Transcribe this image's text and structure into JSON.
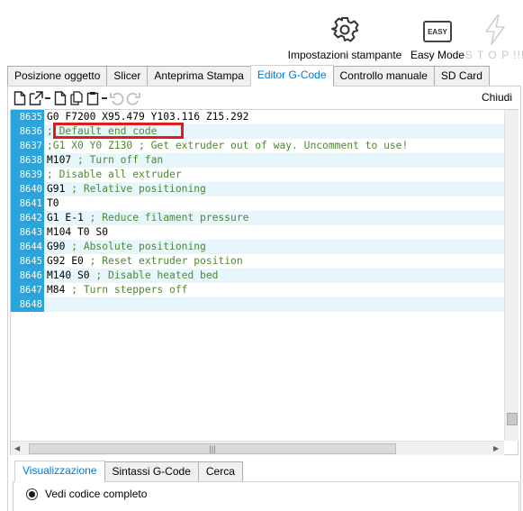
{
  "toolbar": {
    "settings_label": "Impostazioni stampante",
    "settings_icon": "gear-icon",
    "easy_label": "Easy Mode",
    "easy_badge": "EASY",
    "stop_label": "S T O P !!!",
    "stop_icon": "lightning-icon"
  },
  "main_tabs": [
    {
      "label": "Posizione oggetto"
    },
    {
      "label": "Slicer"
    },
    {
      "label": "Anteprima Stampa"
    },
    {
      "label": "Editor G-Code",
      "active": true
    },
    {
      "label": "Controllo manuale"
    },
    {
      "label": "SD Card"
    }
  ],
  "editor_toolbar": {
    "icons": [
      "new-file-icon",
      "export-icon",
      "separator",
      "file-icon",
      "copy-icon",
      "paste-icon",
      "separator",
      "undo-icon",
      "redo-icon"
    ],
    "close_label": "Chiudi"
  },
  "code_lines": [
    {
      "num": "8635",
      "cmd": "G0 F7200 X95.479 Y103.116 Z15.292",
      "comment": ""
    },
    {
      "num": "8636",
      "cmd": "",
      "comment": "; Default end code"
    },
    {
      "num": "8637",
      "cmd": "",
      "comment": ";G1 X0 Y0 Z130 ; Get extruder out of way. Uncomment to use!"
    },
    {
      "num": "8638",
      "cmd": "M107 ",
      "comment": "; Turn off fan"
    },
    {
      "num": "8639",
      "cmd": "",
      "comment": "; Disable all extruder"
    },
    {
      "num": "8640",
      "cmd": "G91 ",
      "comment": "; Relative positioning"
    },
    {
      "num": "8641",
      "cmd": "T0",
      "comment": ""
    },
    {
      "num": "8642",
      "cmd": "G1 E-1 ",
      "comment": "; Reduce filament pressure"
    },
    {
      "num": "8643",
      "cmd": "M104 T0 S0",
      "comment": ""
    },
    {
      "num": "8644",
      "cmd": "G90 ",
      "comment": "; Absolute positioning"
    },
    {
      "num": "8645",
      "cmd": "G92 E0 ",
      "comment": "; Reset extruder position"
    },
    {
      "num": "8646",
      "cmd": "M140 S0 ",
      "comment": "; Disable heated bed"
    },
    {
      "num": "8647",
      "cmd": "M84 ",
      "comment": "; Turn steppers off"
    },
    {
      "num": "8648",
      "cmd": "",
      "comment": ""
    }
  ],
  "bottom_tabs": [
    {
      "label": "Visualizzazione",
      "active": true
    },
    {
      "label": "Sintassi G-Code"
    },
    {
      "label": "Cerca"
    }
  ],
  "view_option": {
    "label": "Vedi codice completo",
    "checked": true
  },
  "colors": {
    "accent": "#0078d7",
    "line_number_bg": "#2ba3dc",
    "comment": "#4c8a2f",
    "highlight": "#e21b1b"
  }
}
